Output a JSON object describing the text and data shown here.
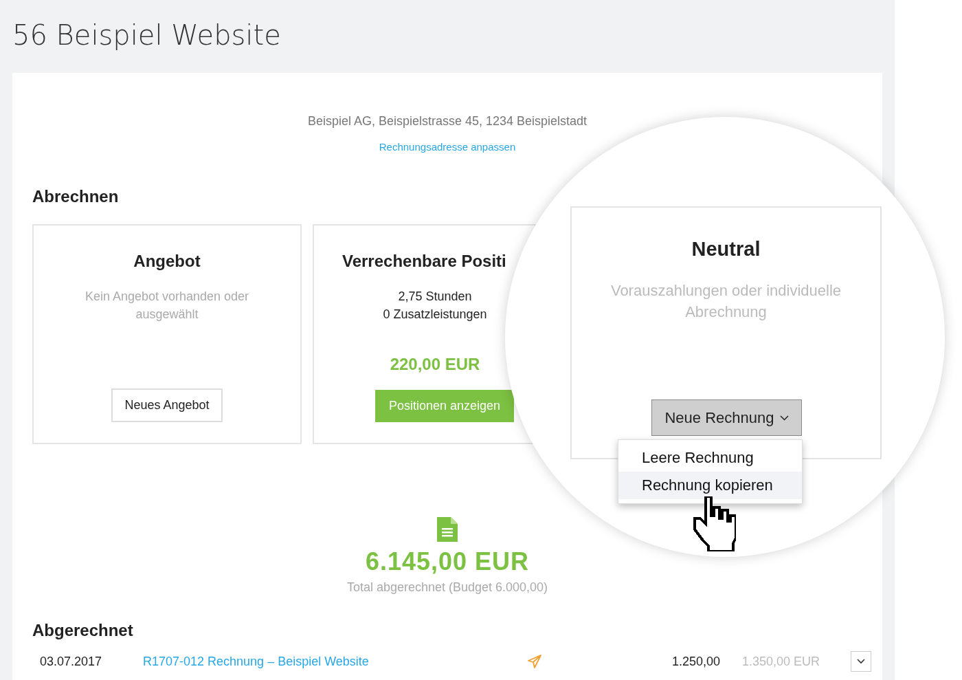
{
  "page_title": "56 Beispiel Website",
  "address": {
    "text": "Beispiel AG, Beispielstrasse 45, 1234 Beispielstadt",
    "link": "Rechnungsadresse anpassen"
  },
  "billing": {
    "heading": "Abrechnen",
    "cards": [
      {
        "kind": "offer",
        "title": "Angebot",
        "description": "Kein Angebot vorhanden oder ausgewählt",
        "button": "Neues Angebot"
      },
      {
        "kind": "positions",
        "title": "Verrechenbare Positi",
        "lines": [
          "2,75 Stunden",
          "0 Zusatzleistungen"
        ],
        "amount": "220,00 EUR",
        "button": "Positionen anzeigen"
      }
    ]
  },
  "magnifier": {
    "card": {
      "title": "Neutral",
      "description": "Vorauszahlungen oder individuelle Abrechnung",
      "button": "Neue Rechnung"
    },
    "menu": [
      {
        "label": "Leere Rechnung",
        "selected": false
      },
      {
        "label": "Rechnung kopieren",
        "selected": true
      }
    ]
  },
  "total": {
    "amount": "6.145,00 EUR",
    "caption": "Total abgerechnet (Budget 6.000,00)"
  },
  "invoiced": {
    "heading": "Abgerechnet",
    "rows": [
      {
        "date": "03.07.2017",
        "title": "R1707-012 Rechnung – Beispiel Website",
        "sent": true,
        "net": "1.250,00",
        "gross": "1.350,00 EUR"
      }
    ]
  }
}
